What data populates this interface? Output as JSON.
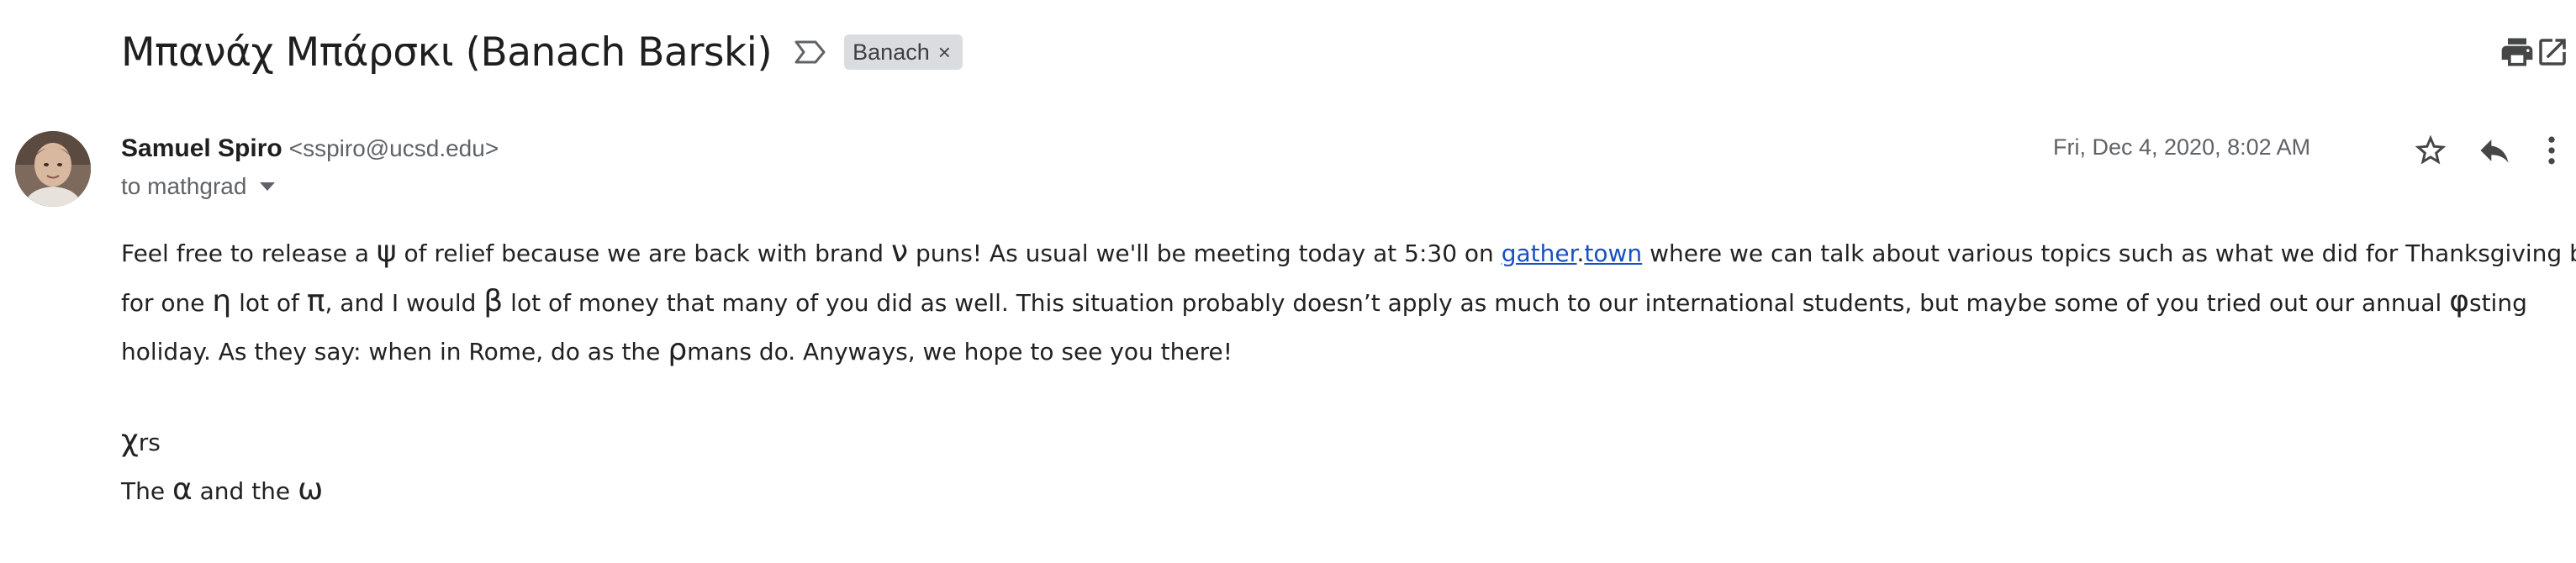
{
  "subject": "Μπανάχ Μπάρσκι (Banach Barski)",
  "label": {
    "text": "Banach",
    "remove_glyph": "×"
  },
  "icons": {
    "important_marker": "label-important-outline-icon",
    "print": "print-icon",
    "open_new_window": "open-in-new-window-icon",
    "star": "star-outline-icon",
    "reply": "reply-icon",
    "more": "more-vert-icon"
  },
  "sender": {
    "name": "Samuel Spiro",
    "email": "<sspiro@ucsd.edu>",
    "to": "to mathgrad"
  },
  "date": "Fri, Dec 4, 2020, 8:02 AM",
  "body": {
    "line1": {
      "a": "Feel free to release a ",
      "psi": "ψ",
      "b": " of relief because we are back with brand ",
      "nu": "ν",
      "c": " puns!  As usual we'll be meeting today at 5:30 on ",
      "link1": "gather",
      "dot": ".",
      "link2": "town",
      "d": " where we can talk about various topics such as what we did for Thanksgiving break.  I"
    },
    "line2": {
      "a": "for one ",
      "eta": "η",
      "b": " lot of ",
      "pi": "π",
      "c": ", and I would ",
      "beta": "β",
      "d": " lot of money that many of you did as well.  This situation probably doesn’t apply as much to our international students, but maybe some of you tried out our annual ",
      "phi": "φ",
      "e": "sting"
    },
    "line3": {
      "a": "holiday.  As they say: when in Rome, do as the ",
      "rho": "ρ",
      "b": "mans do.  Anyways, we hope to see you there!"
    },
    "signoff": {
      "chi": "χ",
      "rs": "rs"
    },
    "signature": {
      "a": "The ",
      "alpha": "α",
      "b": " and the ",
      "omega": "ω"
    }
  },
  "colors": {
    "link": "#1a4fc4",
    "chip_bg": "#dadce0",
    "secondary_text": "#5f6368"
  }
}
